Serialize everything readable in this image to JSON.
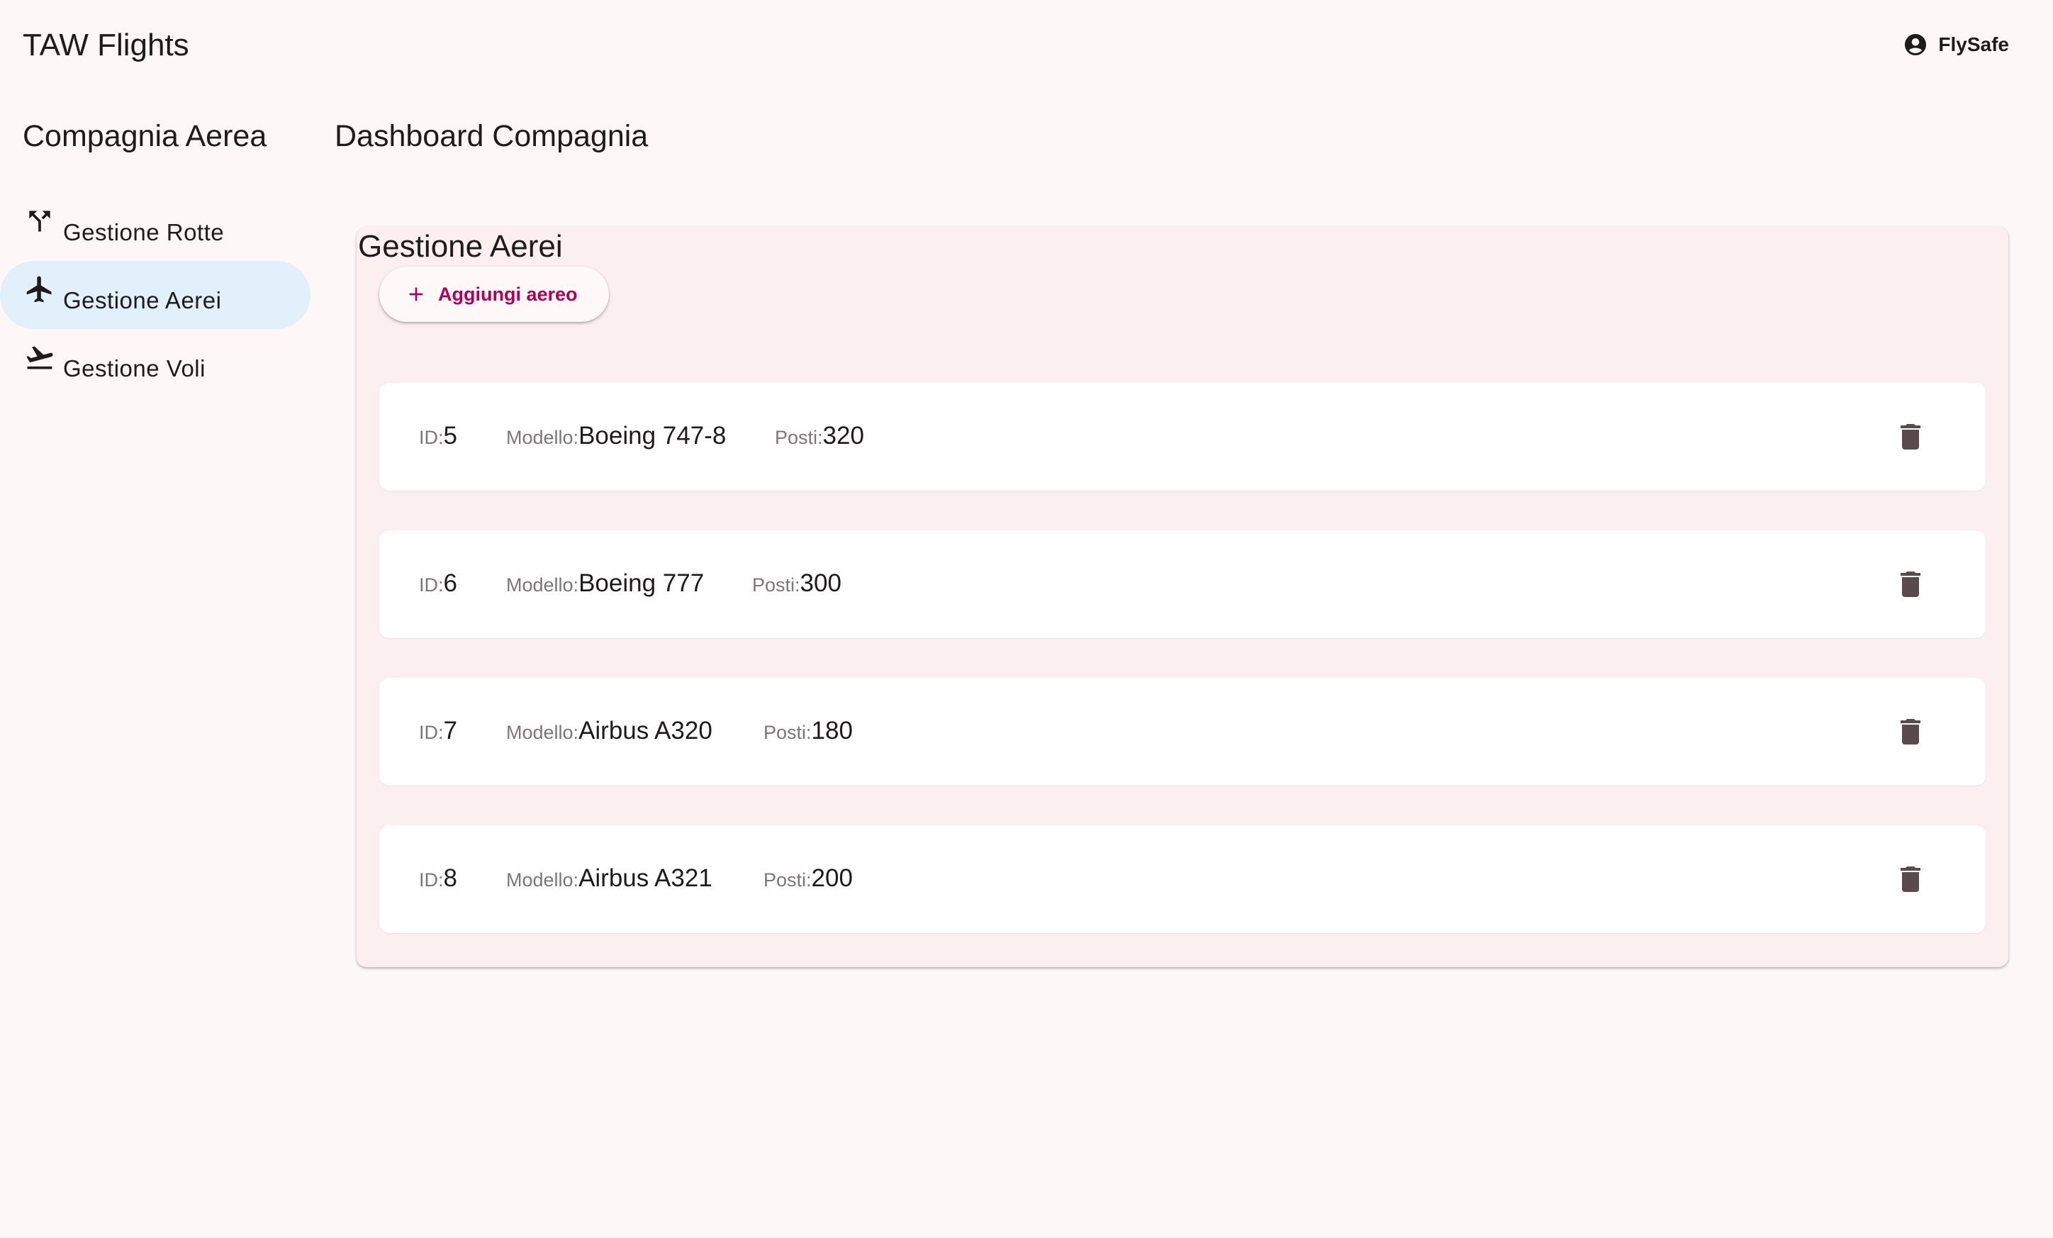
{
  "header": {
    "app_title": "TAW Flights",
    "account_name": "FlySafe",
    "account_icon": "account-circle-icon"
  },
  "sidebar": {
    "title": "Compagnia Aerea",
    "items": [
      {
        "label": "Gestione Rotte",
        "icon": "route-fork-icon",
        "active": false
      },
      {
        "label": "Gestione Aerei",
        "icon": "airplane-icon",
        "active": true
      },
      {
        "label": "Gestione Voli",
        "icon": "flight-takeoff-icon",
        "active": false
      }
    ]
  },
  "main": {
    "page_title": "Dashboard Compagnia",
    "card": {
      "title": "Gestione Aerei",
      "add_button_label": "Aggiungi aereo",
      "field_labels": {
        "id": "ID:",
        "model": "Modello:",
        "seats": "Posti:"
      },
      "planes": [
        {
          "id": "5",
          "model": "Boeing 747-8",
          "seats": "320"
        },
        {
          "id": "6",
          "model": "Boeing 777",
          "seats": "300"
        },
        {
          "id": "7",
          "model": "Airbus A320",
          "seats": "180"
        },
        {
          "id": "8",
          "model": "Airbus A321",
          "seats": "200"
        }
      ]
    }
  },
  "colors": {
    "background": "#fdf7f7",
    "card_background": "#fcefef",
    "active_nav": "#e1f0fb",
    "accent": "#b1005a",
    "delete_icon": "#5a4a4d"
  }
}
